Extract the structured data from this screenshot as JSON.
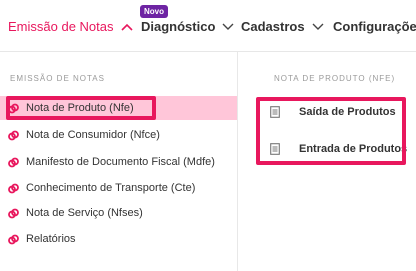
{
  "nav": {
    "items": [
      {
        "label": "Emissão de Notas",
        "active": true
      },
      {
        "label": "Diagnóstico",
        "badge": "Novo"
      },
      {
        "label": "Cadastros"
      },
      {
        "label": "Configurações"
      }
    ]
  },
  "left_menu": {
    "title": "EMISSÃO DE NOTAS",
    "items": [
      {
        "label": "Nota de Produto (Nfe)",
        "selected": true
      },
      {
        "label": "Nota de Consumidor (Nfce)"
      },
      {
        "label": "Manifesto de Documento Fiscal (Mdfe)"
      },
      {
        "label": "Conhecimento de Transporte (Cte)"
      },
      {
        "label": "Nota de Serviço (Nfses)"
      },
      {
        "label": "Relatórios"
      }
    ]
  },
  "sub_menu": {
    "title": "NOTA DE PRODUTO (NFE)",
    "items": [
      {
        "label": "Saída de Produtos"
      },
      {
        "label": "Entrada de Produtos"
      }
    ]
  },
  "colors": {
    "accent": "#e8175d",
    "badge": "#6e24a3",
    "selected_bg": "#ffc6d9"
  },
  "icons": {
    "menu_bullet": "link-bullet-icon",
    "sub_item": "document-icon",
    "nav_chevron": "chevron-icon"
  }
}
